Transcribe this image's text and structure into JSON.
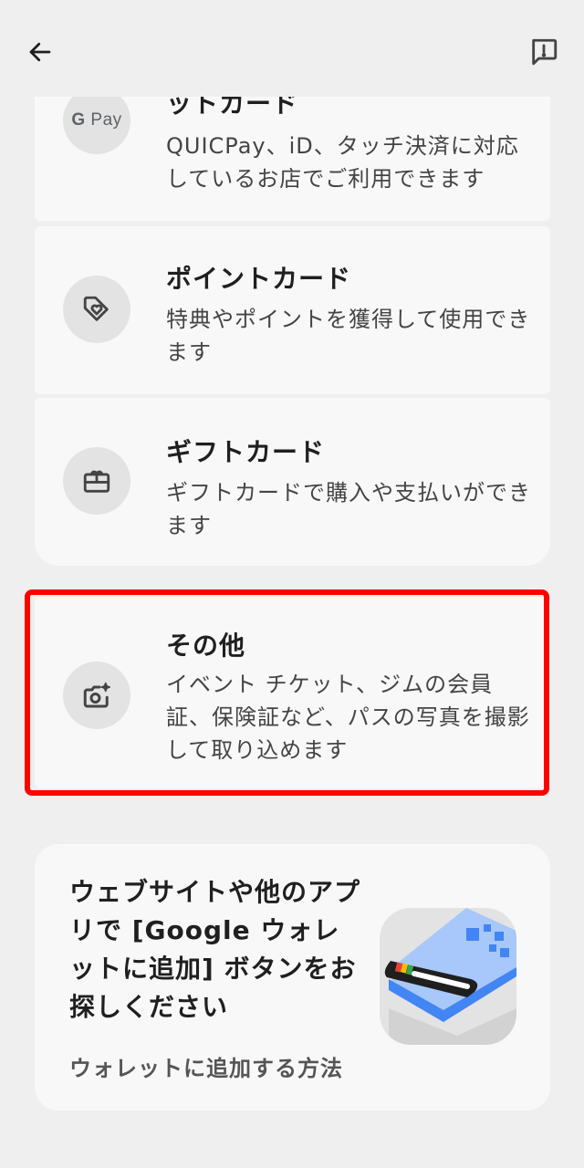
{
  "header": {
    "back_icon": "arrow-left-icon",
    "feedback_icon": "feedback-icon"
  },
  "items": {
    "gpay": {
      "logo_text_g": "G",
      "logo_text_pay": "Pay",
      "title": "ットカード",
      "desc": "QUICPay、iD、タッチ決済に対応しているお店でご利用できます"
    },
    "point": {
      "title": "ポイントカード",
      "desc": "特典やポイントを獲得して使用できます",
      "icon": "tag-heart-icon"
    },
    "gift": {
      "title": "ギフトカード",
      "desc": "ギフトカードで購入や支払いができます",
      "icon": "gift-card-icon"
    },
    "other": {
      "title": "その他",
      "desc": "イベント チケット、ジムの会員証、保険証など、パスの写真を撮影して取り込めます",
      "icon": "camera-sparkle-icon"
    }
  },
  "promo": {
    "title": "ウェブサイトや他のアプリで [Google ウォレットに追加] ボタンをお探しください",
    "link": "ウォレットに追加する方法",
    "illustration": "wallet-pass-illustration"
  },
  "colors": {
    "background": "#efefef",
    "card": "#f8f8f8",
    "icon_circle": "#e3e3e3",
    "highlight": "#ff0000"
  }
}
